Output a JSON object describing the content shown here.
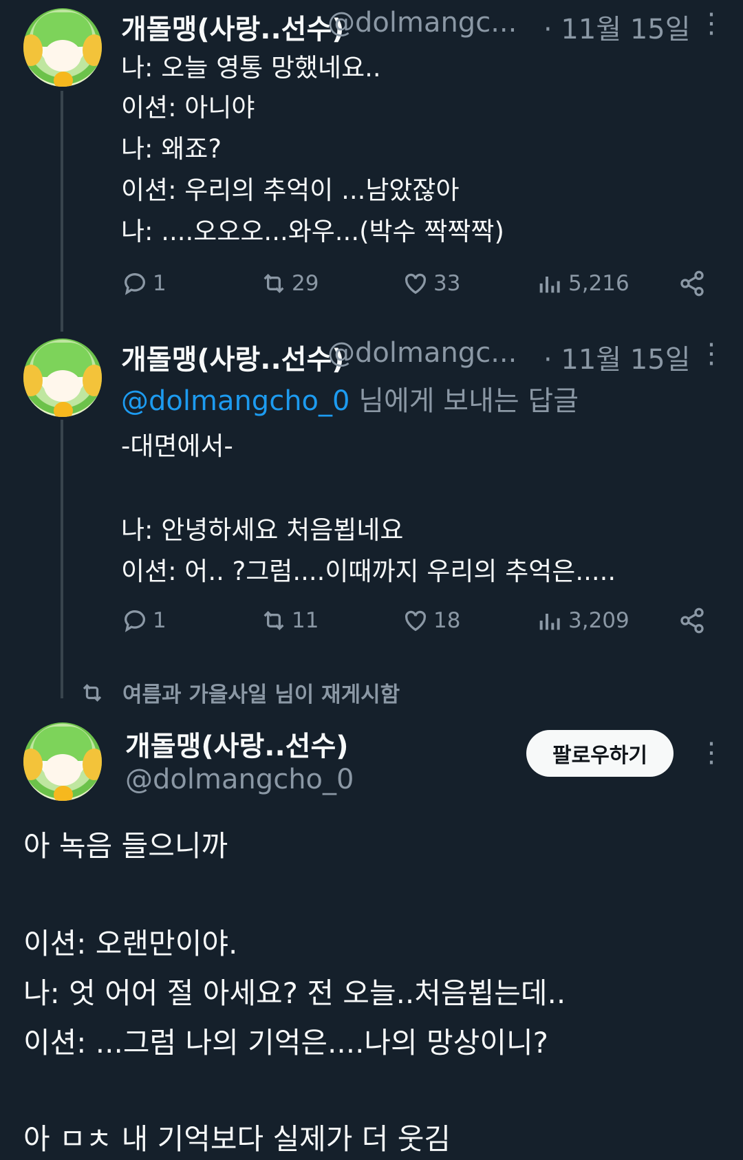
{
  "tweets": [
    {
      "name": "개돌맹(사랑..선수)",
      "handle": "@dolmangc...",
      "date": "· 11월 15일",
      "lines": [
        "나: 오늘 영통 망했네요..",
        "이션: 아니야",
        "나: 왜죠?",
        "이션: 우리의 추억이 ...남았잖아",
        "나: ....오오오...와우...(박수 짝짝짝)"
      ],
      "stats": {
        "replies": "1",
        "retweets": "29",
        "likes": "33",
        "views": "5,216"
      }
    },
    {
      "name": "개돌맹(사랑..선수)",
      "handle": "@dolmangc...",
      "date": "· 11월 15일",
      "reply_mention": "@dolmangcho_0",
      "reply_suffix": "님에게 보내는 답글",
      "lines": [
        "-대면에서-",
        "",
        "나: 안녕하세요 처음뵙네요",
        "이션: 어.. ?그럼....이때까지 우리의 추억은....."
      ],
      "stats": {
        "replies": "1",
        "retweets": "11",
        "likes": "18",
        "views": "3,209"
      }
    }
  ],
  "retweet_notice": "여름과 가을사일 님이 재게시함",
  "main_tweet": {
    "name": "개돌맹(사랑..선수)",
    "handle": "@dolmangcho_0",
    "follow_label": "팔로우하기",
    "lines": [
      "아 녹음 들으니까",
      "",
      "이션: 오랜만이야.",
      "나: 엇 어어 절 아세요? 전 오늘..처음뵙는데..",
      "이션: ...그럼 나의 기억은....나의 망상이니?",
      "",
      "아 ㅁㅊ 내 기억보다 실제가 더 웃김"
    ]
  },
  "icons": [
    "reply-icon",
    "retweet-icon",
    "like-icon",
    "views-icon",
    "share-icon",
    "more-icon"
  ]
}
